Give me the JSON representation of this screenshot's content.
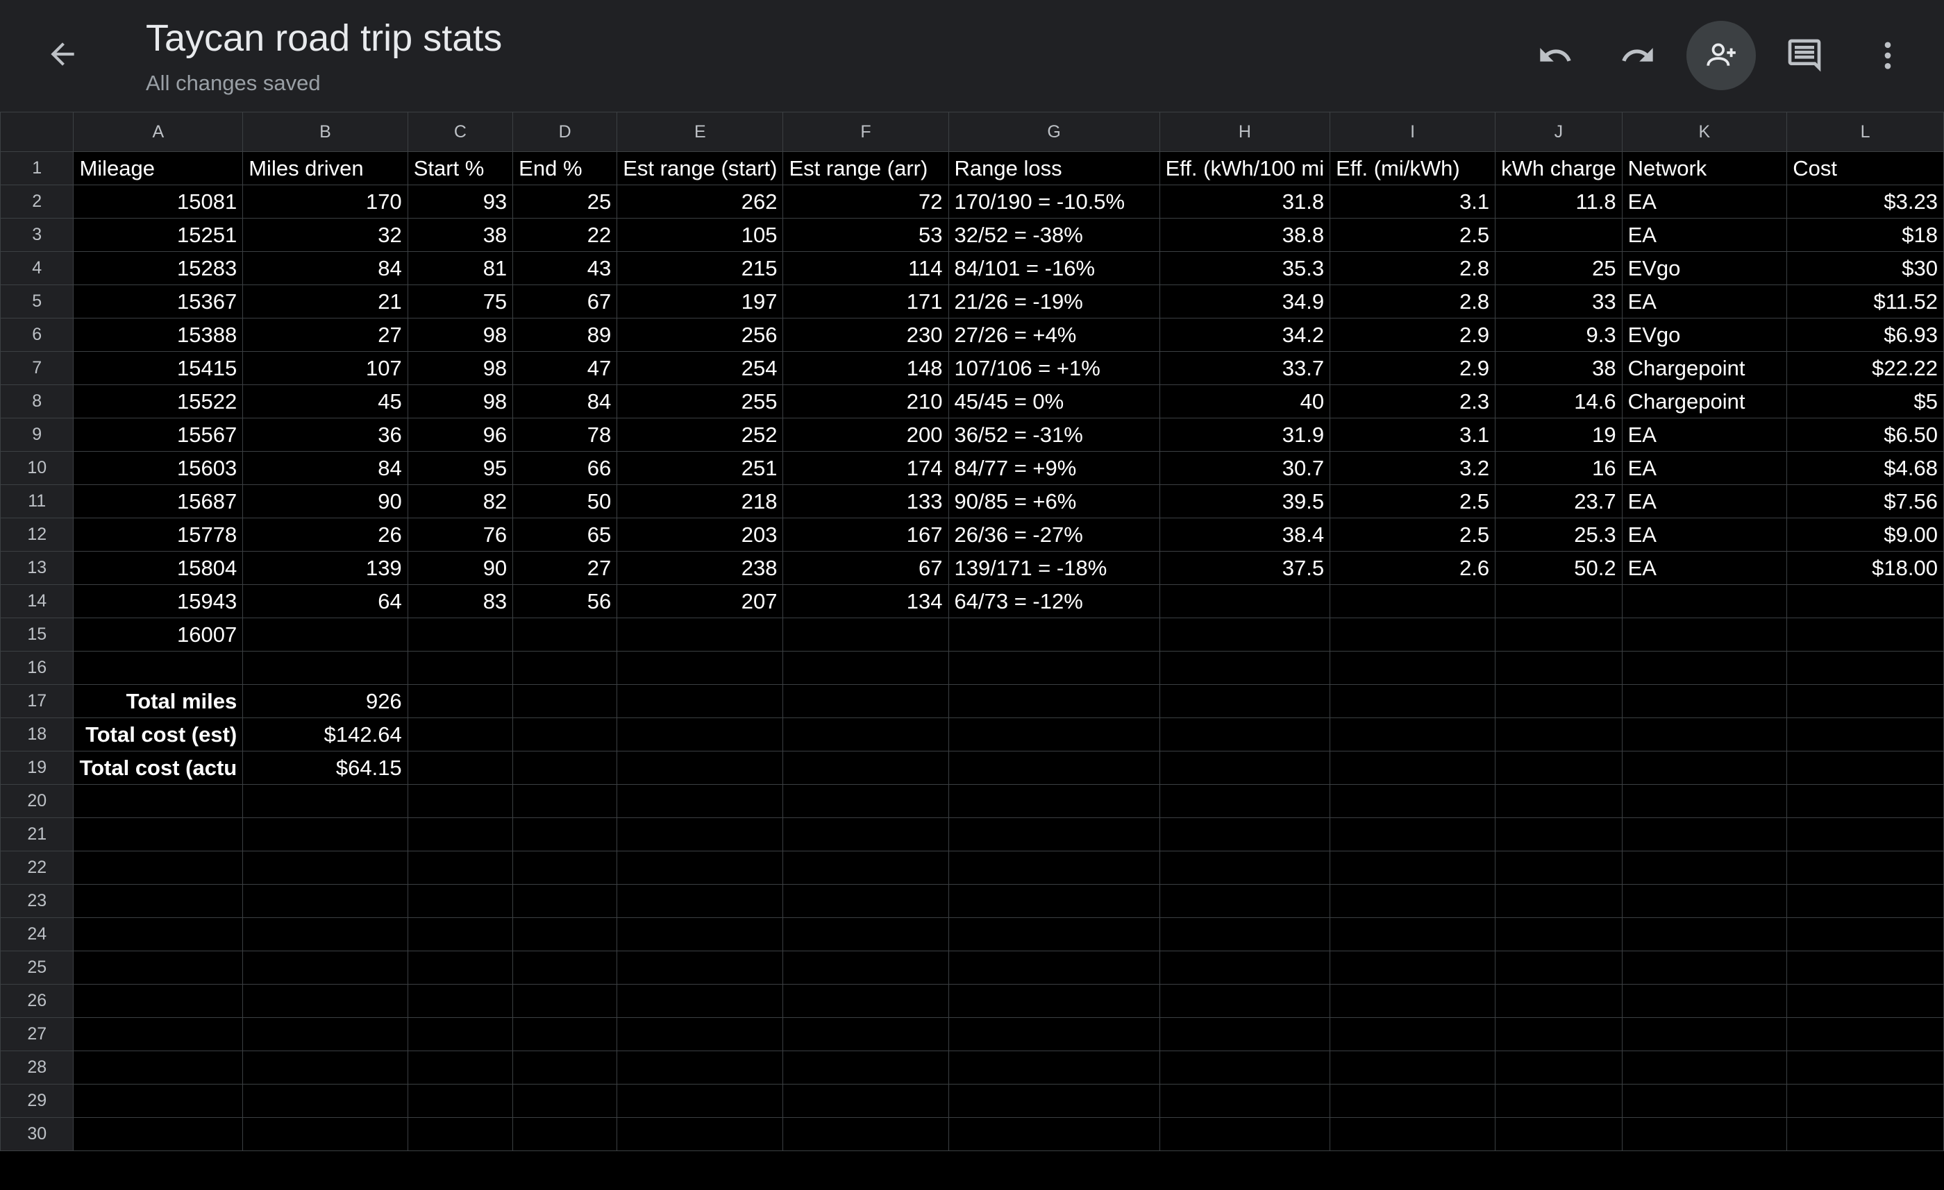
{
  "app": {
    "title": "Taycan road trip stats",
    "status": "All changes saved",
    "icons": {
      "back": "arrow-left-icon",
      "undo": "undo-icon",
      "redo": "redo-icon",
      "share": "add-person-icon",
      "comments": "comment-icon",
      "more": "more-vertical-icon"
    },
    "colors": {
      "toolbar_bg": "#202124",
      "share_bg": "#3c4043",
      "grid_bg": "#000000",
      "gridline": "#3c4043"
    }
  },
  "sheet": {
    "columns": [
      "A",
      "B",
      "C",
      "D",
      "E",
      "F",
      "G",
      "H",
      "I",
      "J",
      "K",
      "L"
    ],
    "row_numbers": [
      "1",
      "2",
      "3",
      "4",
      "5",
      "6",
      "7",
      "8",
      "9",
      "10",
      "11",
      "12",
      "13",
      "14",
      "15",
      "16",
      "17",
      "18",
      "19",
      "20",
      "21",
      "22",
      "23",
      "24",
      "25",
      "26",
      "27",
      "28",
      "29",
      "30"
    ],
    "rows": [
      [
        "Mileage",
        "Miles driven",
        "Start %",
        "End %",
        "Est range (start)",
        "Est range (arr)",
        "Range loss",
        "Eff. (kWh/100 mi",
        "Eff. (mi/kWh)",
        "kWh charge",
        "Network",
        "Cost"
      ],
      [
        "15081",
        "170",
        "93",
        "25",
        "262",
        "72",
        "170/190 = -10.5%",
        "31.8",
        "3.1",
        "11.8",
        "EA",
        "$3.23"
      ],
      [
        "15251",
        "32",
        "38",
        "22",
        "105",
        "53",
        "32/52 = -38%",
        "38.8",
        "2.5",
        "",
        "EA",
        "$18"
      ],
      [
        "15283",
        "84",
        "81",
        "43",
        "215",
        "114",
        "84/101 = -16%",
        "35.3",
        "2.8",
        "25",
        "EVgo",
        "$30"
      ],
      [
        "15367",
        "21",
        "75",
        "67",
        "197",
        "171",
        "21/26 = -19%",
        "34.9",
        "2.8",
        "33",
        "EA",
        "$11.52"
      ],
      [
        "15388",
        "27",
        "98",
        "89",
        "256",
        "230",
        "27/26 = +4%",
        "34.2",
        "2.9",
        "9.3",
        "EVgo",
        "$6.93"
      ],
      [
        "15415",
        "107",
        "98",
        "47",
        "254",
        "148",
        "107/106 = +1%",
        "33.7",
        "2.9",
        "38",
        "Chargepoint",
        "$22.22"
      ],
      [
        "15522",
        "45",
        "98",
        "84",
        "255",
        "210",
        "45/45 = 0%",
        "40",
        "2.3",
        "14.6",
        "Chargepoint",
        "$5"
      ],
      [
        "15567",
        "36",
        "96",
        "78",
        "252",
        "200",
        "36/52 = -31%",
        "31.9",
        "3.1",
        "19",
        "EA",
        "$6.50"
      ],
      [
        "15603",
        "84",
        "95",
        "66",
        "251",
        "174",
        "84/77 = +9%",
        "30.7",
        "3.2",
        "16",
        "EA",
        "$4.68"
      ],
      [
        "15687",
        "90",
        "82",
        "50",
        "218",
        "133",
        "90/85 = +6%",
        "39.5",
        "2.5",
        "23.7",
        "EA",
        "$7.56"
      ],
      [
        "15778",
        "26",
        "76",
        "65",
        "203",
        "167",
        "26/36 = -27%",
        "38.4",
        "2.5",
        "25.3",
        "EA",
        "$9.00"
      ],
      [
        "15804",
        "139",
        "90",
        "27",
        "238",
        "67",
        "139/171 = -18%",
        "37.5",
        "2.6",
        "50.2",
        "EA",
        "$18.00"
      ],
      [
        "15943",
        "64",
        "83",
        "56",
        "207",
        "134",
        "64/73 = -12%",
        "",
        "",
        "",
        "",
        ""
      ],
      [
        "16007",
        "",
        "",
        "",
        "",
        "",
        "",
        "",
        "",
        "",
        "",
        ""
      ],
      [
        "",
        "",
        "",
        "",
        "",
        "",
        "",
        "",
        "",
        "",
        "",
        ""
      ],
      [
        "Total miles",
        "926",
        "",
        "",
        "",
        "",
        "",
        "",
        "",
        "",
        "",
        ""
      ],
      [
        "Total cost (est)",
        "$142.64",
        "",
        "",
        "",
        "",
        "",
        "",
        "",
        "",
        "",
        ""
      ],
      [
        "Total cost (actu",
        "$64.15",
        "",
        "",
        "",
        "",
        "",
        "",
        "",
        "",
        "",
        ""
      ],
      [
        "",
        "",
        "",
        "",
        "",
        "",
        "",
        "",
        "",
        "",
        "",
        ""
      ],
      [
        "",
        "",
        "",
        "",
        "",
        "",
        "",
        "",
        "",
        "",
        "",
        ""
      ],
      [
        "",
        "",
        "",
        "",
        "",
        "",
        "",
        "",
        "",
        "",
        "",
        ""
      ],
      [
        "",
        "",
        "",
        "",
        "",
        "",
        "",
        "",
        "",
        "",
        "",
        ""
      ],
      [
        "",
        "",
        "",
        "",
        "",
        "",
        "",
        "",
        "",
        "",
        "",
        ""
      ],
      [
        "",
        "",
        "",
        "",
        "",
        "",
        "",
        "",
        "",
        "",
        "",
        ""
      ],
      [
        "",
        "",
        "",
        "",
        "",
        "",
        "",
        "",
        "",
        "",
        "",
        ""
      ],
      [
        "",
        "",
        "",
        "",
        "",
        "",
        "",
        "",
        "",
        "",
        "",
        ""
      ],
      [
        "",
        "",
        "",
        "",
        "",
        "",
        "",
        "",
        "",
        "",
        "",
        ""
      ],
      [
        "",
        "",
        "",
        "",
        "",
        "",
        "",
        "",
        "",
        "",
        "",
        ""
      ],
      [
        "",
        "",
        "",
        "",
        "",
        "",
        "",
        "",
        "",
        "",
        "",
        ""
      ]
    ]
  }
}
